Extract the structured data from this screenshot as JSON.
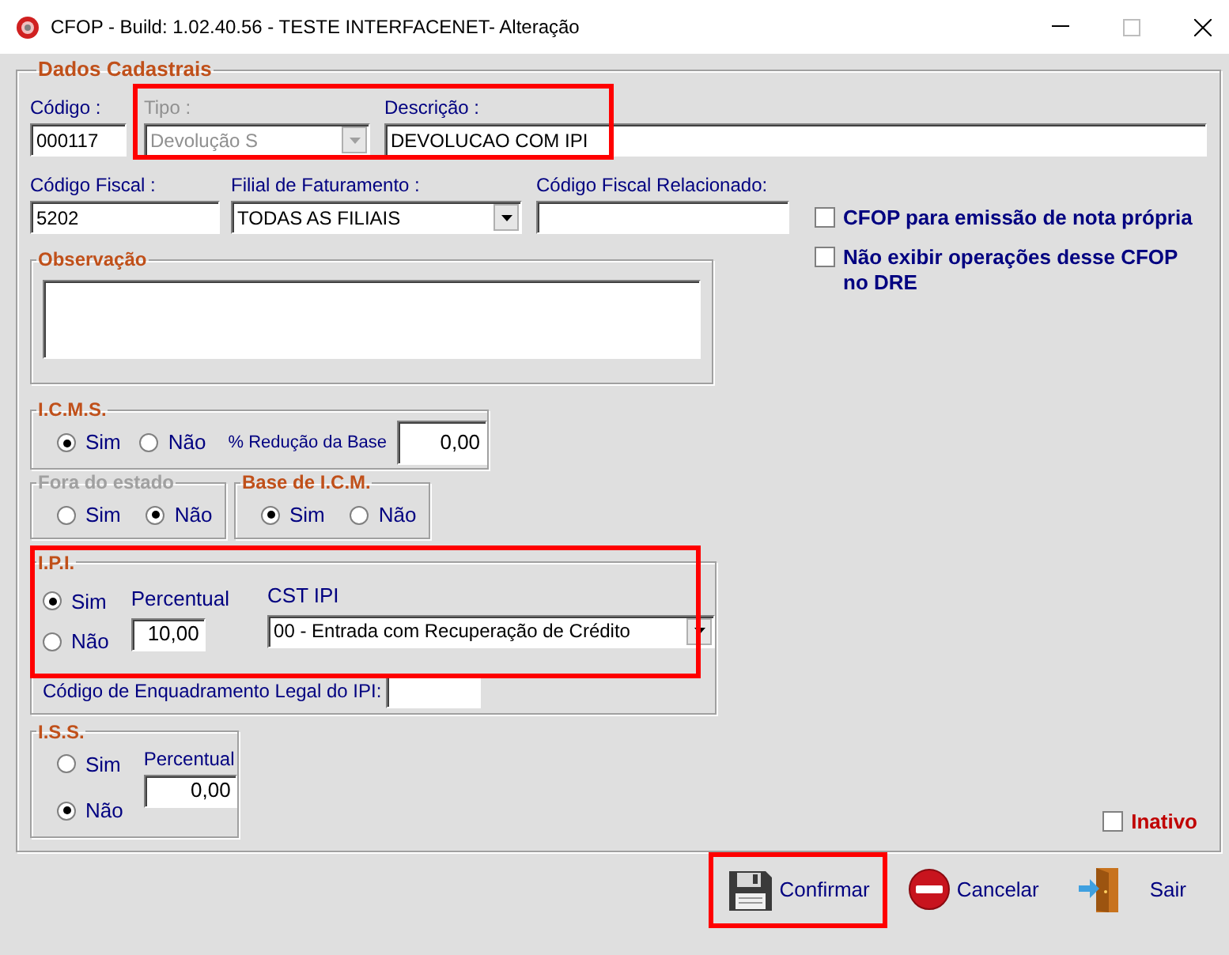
{
  "window": {
    "title": "CFOP - Build: 1.02.40.56 - TESTE INTERFACENET- Alteração"
  },
  "dados_cadastrais": {
    "title": "Dados Cadastrais",
    "codigo": {
      "label": "Código :",
      "value": "000117"
    },
    "tipo": {
      "label": "Tipo :",
      "value": "Devolução S",
      "disabled": true
    },
    "descricao": {
      "label": "Descrição :",
      "value": "DEVOLUCAO COM IPI"
    },
    "tipo_descricao_highlighted": true,
    "codigo_fiscal": {
      "label": "Código Fiscal :",
      "value": "5202"
    },
    "filial": {
      "label": "Filial de Faturamento :",
      "value": "TODAS AS FILIAIS"
    },
    "codigo_fiscal_relacionado": {
      "label": "Código Fiscal Relacionado:"
    },
    "options": [
      {
        "label": "CFOP para emissão de nota própria",
        "checked": false
      },
      {
        "label": "Não exibir operações desse CFOP no DRE",
        "checked": false
      }
    ],
    "observacao": {
      "title": "Observação"
    },
    "icms": {
      "title": "I.C.M.S.",
      "choices": [
        {
          "label": "Sim",
          "selected": true
        },
        {
          "label": "Não",
          "selected": false
        }
      ],
      "reducao": {
        "label": "% Redução da Base",
        "value": "0,00"
      }
    },
    "fora_do_estado": {
      "title": "Fora do estado",
      "disabled": true,
      "choices": [
        {
          "label": "Sim",
          "selected": false
        },
        {
          "label": "Não",
          "selected": true
        }
      ]
    },
    "base_icm": {
      "title": "Base de I.C.M.",
      "choices": [
        {
          "label": "Sim",
          "selected": true
        },
        {
          "label": "Não",
          "selected": false
        }
      ]
    },
    "ipi": {
      "title": "I.P.I.",
      "highlighted": true,
      "choices": [
        {
          "label": "Sim",
          "selected": true
        },
        {
          "label": "Não",
          "selected": false
        }
      ],
      "percentual": {
        "label": "Percentual",
        "value": "10,00"
      },
      "cst": {
        "label": "CST IPI",
        "value": "00 - Entrada com Recuperação de Crédito"
      },
      "enquadramento": {
        "label": "Código de Enquadramento Legal do IPI:"
      }
    },
    "iss": {
      "title": "I.S.S.",
      "choices": [
        {
          "label": "Sim",
          "selected": false
        },
        {
          "label": "Não",
          "selected": true
        }
      ],
      "percentual": {
        "label": "Percentual",
        "value": "0,00"
      }
    },
    "inativo": {
      "label": "Inativo",
      "checked": false
    }
  },
  "buttons": [
    {
      "label": "Confirmar",
      "kind": "save",
      "highlighted": true
    },
    {
      "label": "Cancelar",
      "kind": "cancel",
      "highlighted": false
    },
    {
      "label": "Sair",
      "kind": "exit",
      "highlighted": false
    }
  ]
}
